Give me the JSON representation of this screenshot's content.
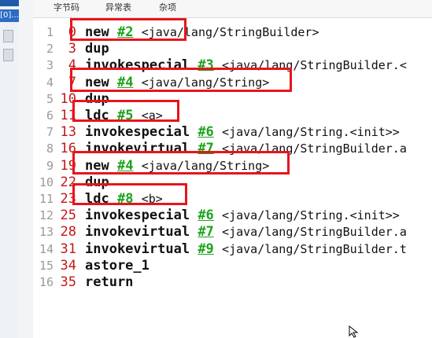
{
  "tabs": [
    "字节码",
    "异常表",
    "杂项"
  ],
  "left_panel": {
    "tab_label": "[0]..."
  },
  "bytecode": [
    {
      "line": "1",
      "offset": "0",
      "op": "new",
      "ref": "#2",
      "sig": "<java/lang/StringBuilder>"
    },
    {
      "line": "2",
      "offset": "3",
      "op": "dup",
      "ref": "",
      "sig": ""
    },
    {
      "line": "3",
      "offset": "4",
      "op": "invokespecial",
      "ref": "#3",
      "sig": "<java/lang/StringBuilder.<"
    },
    {
      "line": "4",
      "offset": "7",
      "op": "new",
      "ref": "#4",
      "sig": "<java/lang/String>"
    },
    {
      "line": "5",
      "offset": "10",
      "op": "dup",
      "ref": "",
      "sig": ""
    },
    {
      "line": "6",
      "offset": "11",
      "op": "ldc",
      "ref": "#5",
      "sig": "<a>"
    },
    {
      "line": "7",
      "offset": "13",
      "op": "invokespecial",
      "ref": "#6",
      "sig": "<java/lang/String.<init>>"
    },
    {
      "line": "8",
      "offset": "16",
      "op": "invokevirtual",
      "ref": "#7",
      "sig": "<java/lang/StringBuilder.a"
    },
    {
      "line": "9",
      "offset": "19",
      "op": "new",
      "ref": "#4",
      "sig": "<java/lang/String>"
    },
    {
      "line": "10",
      "offset": "22",
      "op": "dup",
      "ref": "",
      "sig": ""
    },
    {
      "line": "11",
      "offset": "23",
      "op": "ldc",
      "ref": "#8",
      "sig": "<b>"
    },
    {
      "line": "12",
      "offset": "25",
      "op": "invokespecial",
      "ref": "#6",
      "sig": "<java/lang/String.<init>>"
    },
    {
      "line": "13",
      "offset": "28",
      "op": "invokevirtual",
      "ref": "#7",
      "sig": "<java/lang/StringBuilder.a"
    },
    {
      "line": "14",
      "offset": "31",
      "op": "invokevirtual",
      "ref": "#9",
      "sig": "<java/lang/StringBuilder.t"
    },
    {
      "line": "15",
      "offset": "34",
      "op": "astore_1",
      "ref": "",
      "sig": ""
    },
    {
      "line": "16",
      "offset": "35",
      "op": "return",
      "ref": "",
      "sig": ""
    }
  ],
  "highlight_color": "#e8141c",
  "ref_color": "#1aa31a",
  "offset_color": "#c01818"
}
